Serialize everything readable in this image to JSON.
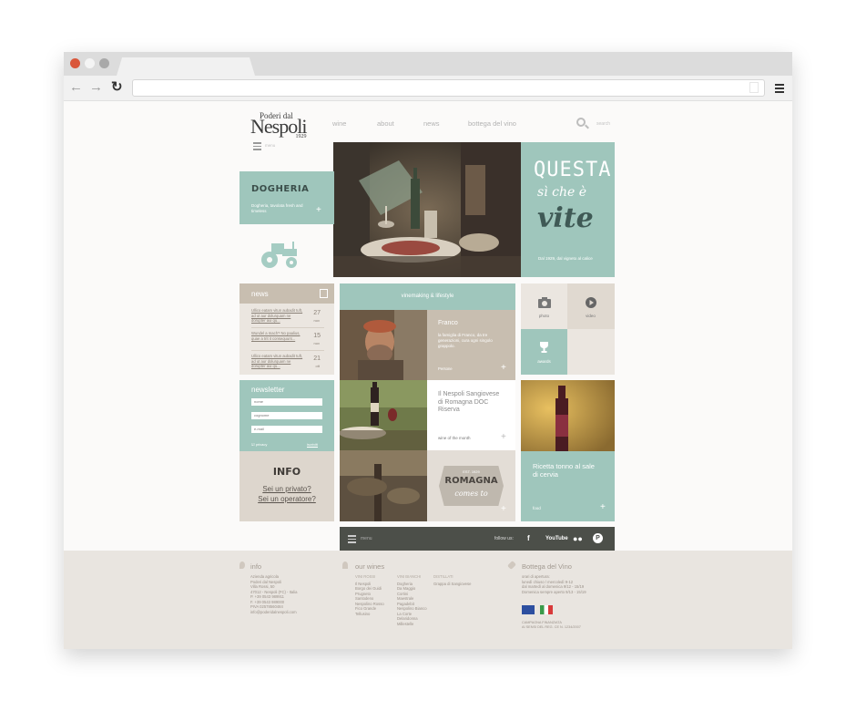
{
  "browser": {
    "url": ""
  },
  "site": {
    "logo": {
      "line1": "Poderi dal",
      "line2": "Nespoli",
      "line3": "1929"
    },
    "nav": [
      "wine",
      "about",
      "news",
      "bottega del vino"
    ],
    "search_label": "search",
    "small_menu_label": "menu",
    "dogheria": {
      "title": "DOGHERIA",
      "text": "Dogheria, tavolata fresh and timeless"
    },
    "questa": {
      "line1": "QUESTA",
      "line2": "sì che è",
      "line3": "vite",
      "caption": "Dal 1929, dal vigneto al calice"
    },
    "news": {
      "title": "news",
      "items": [
        {
          "text": "Ullico eatam vitun aubadit tuft, ad ut aur dolurquam ne dorupter aui qu...",
          "day": "27",
          "month": "nov"
        },
        {
          "text": "Wundel a mach? No paalius, quae a trit it consequunt...",
          "day": "15",
          "month": "nov"
        },
        {
          "text": "Ullico eatam vitun aubadit tuft, ad ut aur dolurquam ne dorupter aui qu...",
          "day": "21",
          "month": "ott"
        }
      ]
    },
    "newsletter": {
      "title": "newsletter",
      "fields": [
        "nome",
        "cognome",
        "e-mail"
      ],
      "privacy": "privacy",
      "submit": "iscriviti"
    },
    "info": {
      "title": "INFO",
      "link1": "Sei un privato?",
      "link2": "Sei un operatore?"
    },
    "vinemaking": {
      "header": "vinemaking & lifestyle",
      "franco_title": "Franco",
      "franco_text": "la famiglia di Franco, da tre generazioni, cura ogni singolo grappolo.",
      "franco_foot": "Persone",
      "wine_title": "Il Nespoli Sangiovese di Romagna DOC Riserva",
      "wine_foot": "wine of the month",
      "romagna_top": "EST. 1929",
      "romagna_mid": "ROMAGNA",
      "romagna_bot": "comes to"
    },
    "media": {
      "photo": "photo",
      "video": "video",
      "awards": "awards"
    },
    "recipe": {
      "text": "Ricetta tonno al sale di cervia",
      "foot": "food"
    },
    "bottombar": {
      "menu": "menu",
      "follow": "follow us:",
      "youtube": "YouTube"
    },
    "footer": {
      "info_title": "info",
      "info_lines": [
        "Azienda agricola",
        "Poderi dal Nespoli",
        "",
        "Villa Rossi, 50",
        "47012 - Nespoli (FC) - Italia",
        "P. +39 0543 989911",
        "F. +39 0543 989000",
        "PIVA 02578560484",
        "info@poderidalnespoli.com"
      ],
      "wines_title": "our wines",
      "wines_col1_head": "VINI ROSSI",
      "wines_col1": [
        "Il Nespoli",
        "Borgo dei Guidi",
        "Prugneto",
        "Santodeno",
        "Nespolino Rosso",
        "Fico Grande",
        "Tellusino"
      ],
      "wines_col2_head": "VINI BIANCHI",
      "wines_col2": [
        "Dogheria",
        "Da Maggio",
        "Cortini",
        "Maestrale",
        "Pagadebit",
        "Nespolino Bianco",
        "La Corte",
        "Delaridonna",
        "Millestelle"
      ],
      "wines_col3_head": "DISTILLATI",
      "wines_col3": [
        "Grappa di Sangiovese"
      ],
      "bottega_title": "Bottega del Vino",
      "bottega_lines": [
        "orari di apertura:",
        "lunedì chiuso / mercoledì 9-12",
        "dal martedì al domenica 9/12 - 15/19",
        "Domenica sempre aperto 9/13 - 15/19"
      ],
      "eu_lines": [
        "CAMPAGNA FINANZIATA",
        "AI SENSI DEL REG. CE N. 1234/2007"
      ]
    }
  }
}
